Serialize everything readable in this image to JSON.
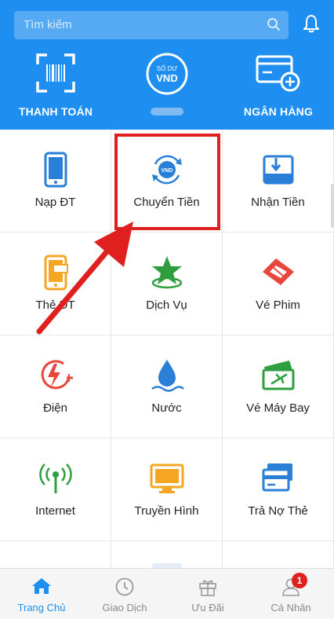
{
  "header": {
    "search_placeholder": "Tìm kiếm",
    "quick_actions": [
      {
        "label": "THANH TOÁN",
        "icon": "barcode-scan-icon"
      },
      {
        "label": "",
        "icon": "balance-vnd-icon",
        "badge_line1": "SỐ DƯ",
        "badge_line2": "VND"
      },
      {
        "label": "NGÂN HÀNG",
        "icon": "add-card-icon"
      }
    ]
  },
  "services": [
    {
      "label": "Nạp ĐT",
      "icon": "phone-topup-icon"
    },
    {
      "label": "Chuyển Tiền",
      "icon": "money-transfer-icon",
      "highlighted": true
    },
    {
      "label": "Nhận Tiền",
      "icon": "receive-money-icon"
    },
    {
      "label": "Thẻ ĐT",
      "icon": "phone-card-icon"
    },
    {
      "label": "Dịch Vụ",
      "icon": "star-service-icon"
    },
    {
      "label": "Vé Phim",
      "icon": "movie-ticket-icon"
    },
    {
      "label": "Điện",
      "icon": "electricity-icon"
    },
    {
      "label": "Nước",
      "icon": "water-drop-icon"
    },
    {
      "label": "Vé Máy Bay",
      "icon": "plane-ticket-icon"
    },
    {
      "label": "Internet",
      "icon": "internet-antenna-icon"
    },
    {
      "label": "Truyền Hình",
      "icon": "tv-icon"
    },
    {
      "label": "Trả Nợ Thẻ",
      "icon": "credit-card-icon"
    }
  ],
  "tabbar": {
    "items": [
      {
        "label": "Trang Chủ",
        "icon": "home-icon",
        "active": true
      },
      {
        "label": "Giao Dịch",
        "icon": "clock-icon"
      },
      {
        "label": "Ưu Đãi",
        "icon": "gift-icon"
      },
      {
        "label": "Cá Nhân",
        "icon": "user-icon"
      }
    ],
    "notification_count": "1"
  },
  "colors": {
    "primary": "#1e8ff0",
    "highlight": "#e0201f",
    "icon_blue": "#2a7fd6",
    "icon_orange": "#f5a623",
    "icon_green": "#2e9e3e",
    "icon_red": "#e8453c"
  }
}
